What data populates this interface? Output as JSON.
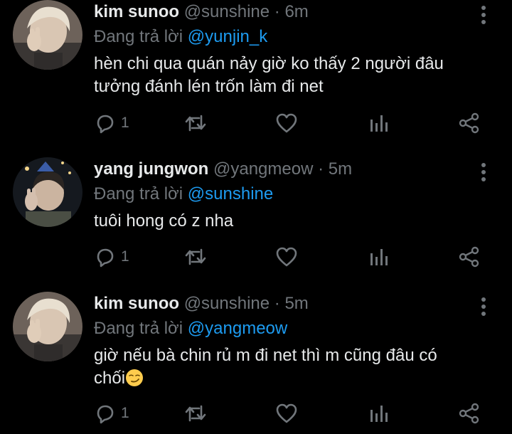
{
  "tweets": [
    {
      "name": "kim sunoo",
      "handle": "@sunshine",
      "time": "6m",
      "reply_prefix": "Đang trả lời ",
      "reply_to": "@yunjin_k",
      "lines": [
        "hèn chi qua quán nảy giờ ko thấy 2 người đâu",
        "tưởng đánh lén trốn làm đi net"
      ],
      "reply_count": "1"
    },
    {
      "name": "yang jungwon",
      "handle": "@yangmeow",
      "time": "5m",
      "reply_prefix": "Đang trả lời ",
      "reply_to": "@sunshine",
      "lines": [
        "tuôi hong có z nha"
      ],
      "reply_count": "1"
    },
    {
      "name": "kim sunoo",
      "handle": "@sunshine",
      "time": "5m",
      "reply_prefix": "Đang trả lời ",
      "reply_to": "@yangmeow",
      "lines": [
        "giờ nếu bà chin rủ m đi net thì m cũng đâu có",
        "chối"
      ],
      "reply_count": "1"
    }
  ],
  "separator": " · ",
  "colors": {
    "background": "#000000",
    "text": "#e7e9ea",
    "muted": "#71767b",
    "link": "#1d9bf0"
  },
  "icons": [
    "reply-icon",
    "retweet-icon",
    "like-icon",
    "analytics-icon",
    "share-icon",
    "more-icon",
    "smirk-emoji"
  ]
}
